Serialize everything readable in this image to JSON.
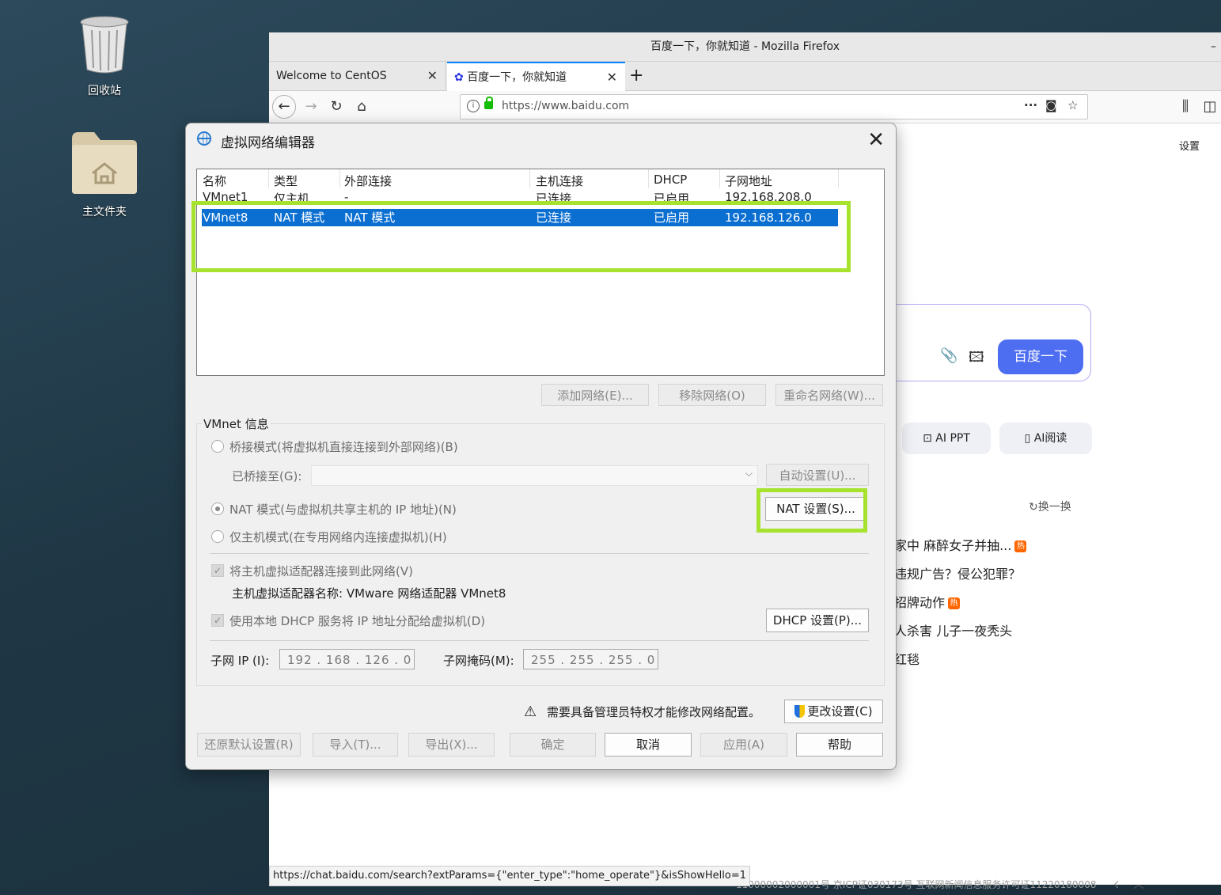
{
  "desktop": {
    "icons": [
      {
        "label": "回收站"
      },
      {
        "label": "主文件夹"
      }
    ]
  },
  "firefox": {
    "window_title": "百度一下，你就知道 - Mozilla Firefox",
    "tabs": [
      {
        "label": "Welcome to CentOS"
      },
      {
        "label": "百度一下，你就知道"
      }
    ],
    "url": "https://www.baidu.com",
    "page": {
      "settings_link": "设置",
      "search_button": "百度一下",
      "chips": [
        "AI PPT",
        "AI阅读"
      ],
      "refresh_label": "换一换",
      "news": [
        {
          "text": "家中 麻醉女子并抽...",
          "hot": true
        },
        {
          "text": "违规广告？侵公犯罪？",
          "hot": false
        },
        {
          "text": "招牌动作",
          "hot": true
        },
        {
          "text": "人杀害 儿子一夜秃头",
          "hot": false
        },
        {
          "text": "红毯",
          "hot": false
        }
      ],
      "hot_badge": "热",
      "footer": "11000002000001号    京ICP证030173号    互联网新闻信息服务许可证11220180008"
    },
    "status_url": "https://chat.baidu.com/search?extParams={\"enter_type\":\"home_operate\"}&isShowHello=1"
  },
  "dialog": {
    "title": "虚拟网络编辑器",
    "columns": [
      "名称",
      "类型",
      "外部连接",
      "主机连接",
      "DHCP",
      "子网地址"
    ],
    "rows": [
      {
        "name": "VMnet1",
        "type": "仅主机...",
        "external": "-",
        "host": "已连接",
        "dhcp": "已启用",
        "subnet": "192.168.208.0"
      },
      {
        "name": "VMnet8",
        "type": "NAT 模式",
        "external": "NAT 模式",
        "host": "已连接",
        "dhcp": "已启用",
        "subnet": "192.168.126.0"
      }
    ],
    "buttons": {
      "add": "添加网络(E)...",
      "remove": "移除网络(O)",
      "rename": "重命名网络(W)...",
      "auto": "自动设置(U)...",
      "nat": "NAT 设置(S)...",
      "dhcp": "DHCP 设置(P)...",
      "change": "更改设置(C)",
      "restore": "还原默认设置(R)",
      "import": "导入(T)...",
      "export": "导出(X)...",
      "ok": "确定",
      "cancel": "取消",
      "apply": "应用(A)",
      "help": "帮助"
    },
    "info_group": "VMnet 信息",
    "bridge_label": "桥接模式(将虚拟机直接连接到外部网络)(B)",
    "bridged_to": "已桥接至(G):",
    "nat_label": "NAT 模式(与虚拟机共享主机的 IP 地址)(N)",
    "hostonly_label": "仅主机模式(在专用网络内连接虚拟机)(H)",
    "connect_adapter": "将主机虚拟适配器连接到此网络(V)",
    "adapter_name": "主机虚拟适配器名称: VMware 网络适配器 VMnet8",
    "dhcp_label": "使用本地 DHCP 服务将 IP 地址分配给虚拟机(D)",
    "subnet_ip_label": "子网 IP (I):",
    "subnet_ip": "192 . 168 . 126 .  0",
    "subnet_mask_label": "子网掩码(M):",
    "subnet_mask": "255 . 255 . 255 .  0",
    "warning": "需要具备管理员特权才能修改网络配置。",
    "highlight_color": "#a6e22e"
  }
}
